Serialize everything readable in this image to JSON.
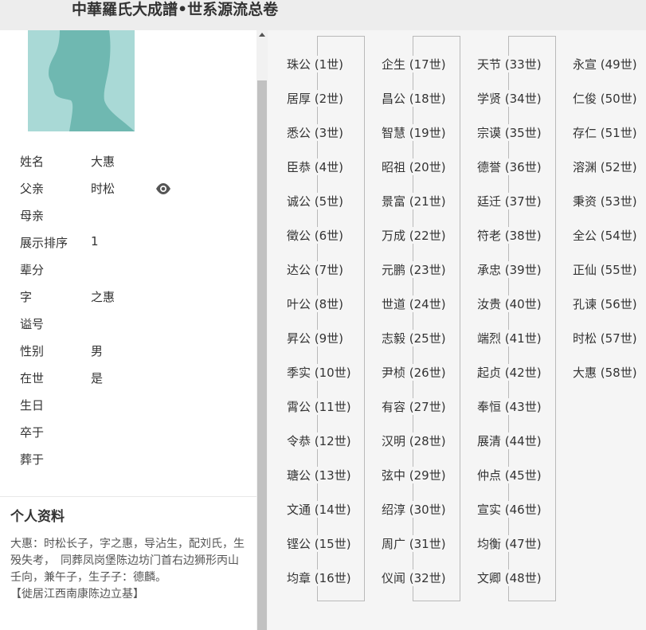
{
  "header": {
    "title": "中華羅氏大成譜•世系源流总卷"
  },
  "person": {
    "fields": [
      {
        "label": "姓名",
        "value": "大惠"
      },
      {
        "label": "父亲",
        "value": "时松"
      },
      {
        "label": "母亲",
        "value": ""
      },
      {
        "label": "展示排序",
        "value": "1"
      },
      {
        "label": "辈分",
        "value": ""
      },
      {
        "label": "字",
        "value": "之惠"
      },
      {
        "label": "谥号",
        "value": ""
      },
      {
        "label": "性别",
        "value": "男"
      },
      {
        "label": "在世",
        "value": "是"
      },
      {
        "label": "生日",
        "value": ""
      },
      {
        "label": "卒于",
        "value": ""
      },
      {
        "label": "葬于",
        "value": ""
      }
    ],
    "icons": {
      "view": "eye-icon",
      "avatar": "person-silhouette"
    }
  },
  "profile": {
    "title": "个人资料",
    "bio": "大惠：时松长子，字之惠，导沾生，配刘氏，生殁失考，　同葬凤岗堡陈边坊门首右边狮形丙山壬向，兼午子，生子子：德麟。",
    "note": "【徙居江西南康陈边立基】"
  },
  "generations": [
    [
      "珠公 (1世)",
      "居厚 (2世)",
      "悉公 (3世)",
      "臣恭 (4世)",
      "诚公 (5世)",
      "徵公 (6世)",
      "达公 (7世)",
      "叶公 (8世)",
      "昇公 (9世)",
      "季实 (10世)",
      "霄公 (11世)",
      "令恭 (12世)",
      "瑭公 (13世)",
      "文通 (14世)",
      "铿公 (15世)",
      "均章 (16世)"
    ],
    [
      "企生 (17世)",
      "昌公 (18世)",
      "智慧 (19世)",
      "昭祖 (20世)",
      "景富 (21世)",
      "万成 (22世)",
      "元鹏 (23世)",
      "世道 (24世)",
      "志毅 (25世)",
      "尹桢 (26世)",
      "有容 (27世)",
      "汉明 (28世)",
      "弦中 (29世)",
      "绍淳 (30世)",
      "周广 (31世)",
      "仪闻 (32世)"
    ],
    [
      "天节 (33世)",
      "学贤 (34世)",
      "宗谟 (35世)",
      "德誉 (36世)",
      "廷迁 (37世)",
      "符老 (38世)",
      "承忠 (39世)",
      "汝贵 (40世)",
      "端烈 (41世)",
      "起贞 (42世)",
      "奉恒 (43世)",
      "展清 (44世)",
      "仲点 (45世)",
      "宣实 (46世)",
      "均衡 (47世)",
      "文卿 (48世)"
    ],
    [
      "永宣 (49世)",
      "仁俊 (50世)",
      "存仁 (51世)",
      "溶渊 (52世)",
      "秉资 (53世)",
      "全公 (54世)",
      "正仙 (55世)",
      "孔谏 (56世)",
      "时松 (57世)",
      "大惠 (58世)"
    ]
  ],
  "colors": {
    "header_bg": "#ededed",
    "avatar_bg": "#a9d9d6",
    "silhouette": "#6fb8b1",
    "panel_bg": "#f5f5f5"
  }
}
